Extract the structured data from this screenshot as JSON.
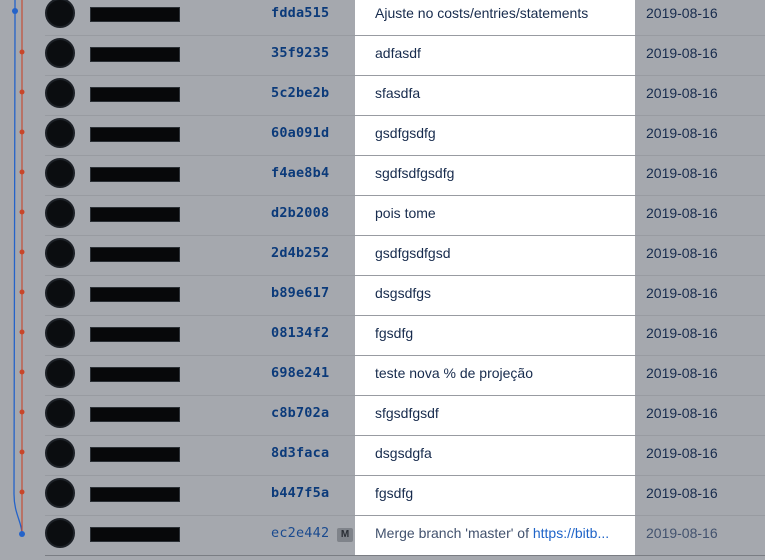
{
  "commits": [
    {
      "hash": "fdda515",
      "message": "Ajuste no costs/entries/statements",
      "date": "2019-08-16"
    },
    {
      "hash": "35f9235",
      "message": "adfasdf",
      "date": "2019-08-16"
    },
    {
      "hash": "5c2be2b",
      "message": "sfasdfa",
      "date": "2019-08-16"
    },
    {
      "hash": "60a091d",
      "message": "gsdfgsdfg",
      "date": "2019-08-16"
    },
    {
      "hash": "f4ae8b4",
      "message": "sgdfsdfgsdfg",
      "date": "2019-08-16"
    },
    {
      "hash": "d2b2008",
      "message": "pois tome",
      "date": "2019-08-16"
    },
    {
      "hash": "2d4b252",
      "message": "gsdfgsdfgsd",
      "date": "2019-08-16"
    },
    {
      "hash": "b89e617",
      "message": "dsgsdfgs",
      "date": "2019-08-16"
    },
    {
      "hash": "08134f2",
      "message": "fgsdfg",
      "date": "2019-08-16"
    },
    {
      "hash": "698e241",
      "message": "teste nova % de projeção",
      "date": "2019-08-16"
    },
    {
      "hash": "c8b702a",
      "message": "sfgsdfgsdf",
      "date": "2019-08-16"
    },
    {
      "hash": "8d3faca",
      "message": "dsgsdgfa",
      "date": "2019-08-16"
    },
    {
      "hash": "b447f5a",
      "message": "fgsdfg",
      "date": "2019-08-16"
    }
  ],
  "merge_commit": {
    "hash": "ec2e442",
    "badge": "M",
    "message_prefix": "Merge branch 'master' of ",
    "message_link": "https://bitb...",
    "date": "2019-08-16"
  },
  "colors": {
    "branch_main": "#2463c9",
    "branch_feature": "#c8462a"
  }
}
